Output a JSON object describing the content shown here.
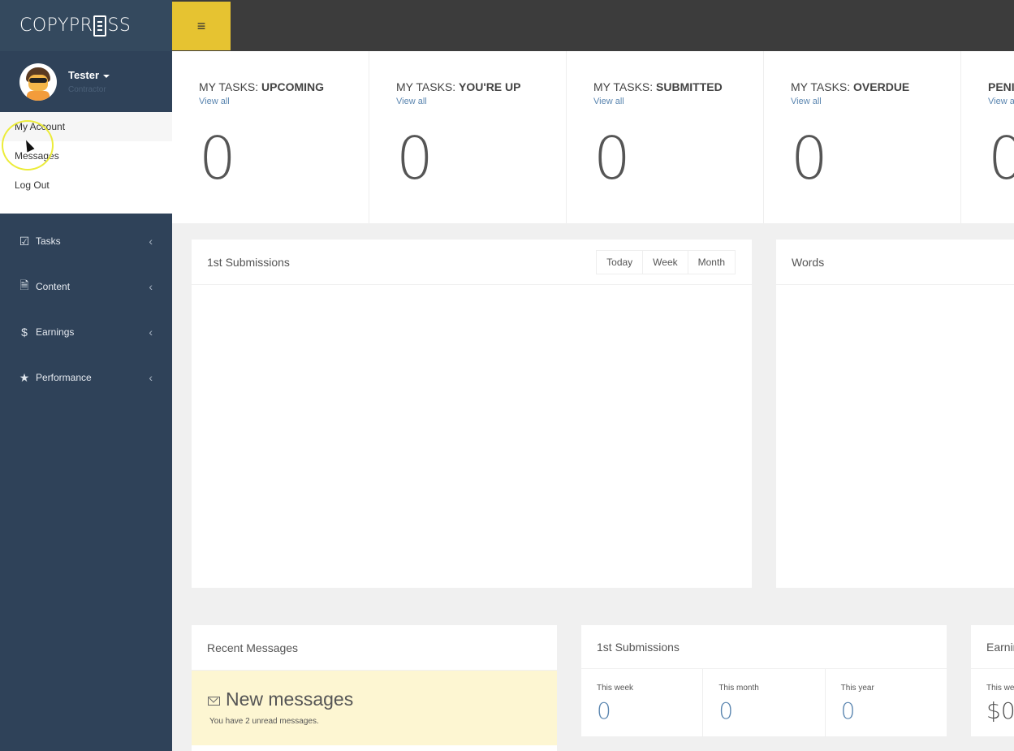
{
  "brand": {
    "logo_text_left": "COPYPR",
    "logo_text_right": "SS"
  },
  "user": {
    "name": "Tester",
    "role": "Contractor"
  },
  "user_menu": [
    "My Account",
    "Messages",
    "Log Out"
  ],
  "nav": [
    {
      "label": "Tasks",
      "icon": "check-square-icon"
    },
    {
      "label": "Content",
      "icon": "document-icon"
    },
    {
      "label": "Earnings",
      "icon": "dollar-icon"
    },
    {
      "label": "Performance",
      "icon": "star-icon"
    }
  ],
  "kpis": [
    {
      "prefix": "MY TASKS: ",
      "title": "UPCOMING",
      "link": "View all",
      "value": "0"
    },
    {
      "prefix": "MY TASKS: ",
      "title": "YOU'RE UP",
      "link": "View all",
      "value": "0"
    },
    {
      "prefix": "MY TASKS: ",
      "title": "SUBMITTED",
      "link": "View all",
      "value": "0"
    },
    {
      "prefix": "MY TASKS: ",
      "title": "OVERDUE",
      "link": "View all",
      "value": "0"
    },
    {
      "prefix": "",
      "title": "PENI",
      "link": "View a",
      "value": "0"
    }
  ],
  "chart_panel": {
    "title": "1st Submissions",
    "ranges": [
      "Today",
      "Week",
      "Month"
    ]
  },
  "words_panel": {
    "title": "Words"
  },
  "recent_messages": {
    "title": "Recent Messages",
    "headline": "New messages",
    "sub": "You have 2 unread messages."
  },
  "submissions_panel": {
    "title": "1st Submissions",
    "stats": [
      {
        "label": "This week",
        "value": "0"
      },
      {
        "label": "This month",
        "value": "0"
      },
      {
        "label": "This year",
        "value": "0"
      }
    ]
  },
  "earnings_panel": {
    "title": "Earnir",
    "stat_label": "This we",
    "stat_value": "$0"
  },
  "colors": {
    "sidebar": "#2f4259",
    "topbar": "#3c3c3c",
    "accent": "#e6c331",
    "link": "#5b86b0"
  }
}
